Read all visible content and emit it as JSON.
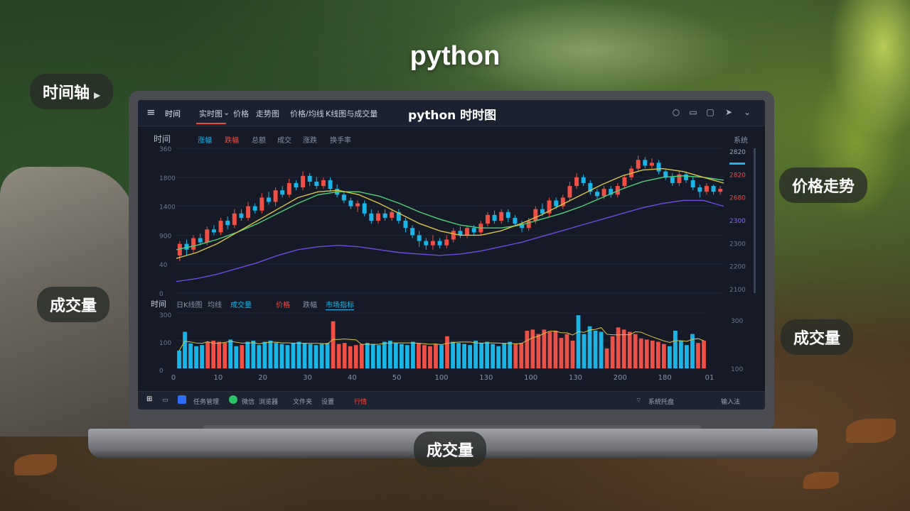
{
  "overlay": {
    "title": "python",
    "tags": {
      "timeline": "时间轴",
      "volume_left": "成交量",
      "price_trend": "价格走势",
      "volume_right": "成交量",
      "volume_bottom": "成交量"
    }
  },
  "app": {
    "title": "python 时时图",
    "tabs": [
      "时间",
      "实时图",
      "价格",
      "走势图",
      "价格/均线",
      "K线图与成交量"
    ],
    "top_icons": [
      "search-icon",
      "layout-icon",
      "window-icon",
      "share-icon",
      "chevron-down-icon"
    ],
    "price_header": {
      "label": "时间",
      "items": [
        "涨幅",
        "跌幅",
        "总额",
        "成交",
        "涨跌",
        "换手率"
      ],
      "right_label": "系统"
    },
    "volume_header": {
      "label": "时间",
      "items": [
        "日K线图",
        "均线",
        "成交量",
        "价格",
        "跌幅",
        "市场指标"
      ]
    },
    "colors": {
      "up": "#ef4f45",
      "down": "#1ab5e6",
      "ma_green": "#4fcf7a",
      "ma_yellow": "#d9c445",
      "ma_purple": "#6c4be0",
      "background": "#151a26"
    },
    "taskbar": {
      "items": [
        "任务管理",
        "微信",
        "浏览器",
        "文件夹",
        "设置",
        "行情"
      ],
      "right_items": [
        "系统托盘",
        "输入法"
      ]
    }
  },
  "chart_data": [
    {
      "type": "candlestick",
      "title": "",
      "y_ticks": [
        "360",
        "1800",
        "1400",
        "900",
        "40",
        "0"
      ],
      "right_ticks": [
        "2820",
        "2820",
        "2680",
        "2300",
        "2300",
        "2200",
        "2100"
      ],
      "ylim": [
        0,
        100
      ],
      "candles": [
        [
          26,
          34,
          22,
          36
        ],
        [
          34,
          30,
          26,
          37
        ],
        [
          30,
          38,
          28,
          40
        ],
        [
          38,
          35,
          33,
          41
        ],
        [
          35,
          44,
          33,
          46
        ],
        [
          44,
          42,
          40,
          47
        ],
        [
          42,
          50,
          40,
          52
        ],
        [
          50,
          47,
          44,
          53
        ],
        [
          47,
          55,
          45,
          58
        ],
        [
          55,
          52,
          50,
          58
        ],
        [
          52,
          60,
          50,
          63
        ],
        [
          60,
          57,
          55,
          62
        ],
        [
          57,
          66,
          55,
          69
        ],
        [
          66,
          63,
          61,
          70
        ],
        [
          63,
          71,
          60,
          73
        ],
        [
          71,
          68,
          66,
          74
        ],
        [
          68,
          76,
          66,
          79
        ],
        [
          76,
          73,
          71,
          78
        ],
        [
          73,
          81,
          71,
          84
        ],
        [
          81,
          77,
          74,
          83
        ],
        [
          77,
          74,
          72,
          80
        ],
        [
          74,
          78,
          72,
          80
        ],
        [
          78,
          72,
          70,
          80
        ],
        [
          72,
          68,
          66,
          75
        ],
        [
          68,
          64,
          62,
          70
        ],
        [
          64,
          60,
          58,
          66
        ],
        [
          60,
          62,
          56,
          64
        ],
        [
          62,
          55,
          53,
          64
        ],
        [
          55,
          50,
          48,
          58
        ],
        [
          50,
          55,
          48,
          57
        ],
        [
          55,
          52,
          50,
          58
        ],
        [
          52,
          56,
          50,
          58
        ],
        [
          56,
          50,
          48,
          58
        ],
        [
          50,
          45,
          42,
          52
        ],
        [
          45,
          40,
          38,
          47
        ],
        [
          40,
          36,
          32,
          43
        ],
        [
          36,
          33,
          30,
          38
        ],
        [
          33,
          36,
          30,
          40
        ],
        [
          36,
          33,
          31,
          38
        ],
        [
          33,
          37,
          31,
          40
        ],
        [
          37,
          43,
          35,
          45
        ],
        [
          43,
          40,
          38,
          46
        ],
        [
          40,
          45,
          38,
          47
        ],
        [
          45,
          42,
          40,
          47
        ],
        [
          42,
          48,
          40,
          50
        ],
        [
          48,
          54,
          46,
          56
        ],
        [
          54,
          50,
          48,
          57
        ],
        [
          50,
          56,
          48,
          58
        ],
        [
          56,
          52,
          49,
          58
        ],
        [
          52,
          48,
          46,
          54
        ],
        [
          48,
          45,
          42,
          50
        ],
        [
          45,
          50,
          43,
          52
        ],
        [
          50,
          58,
          48,
          60
        ],
        [
          58,
          55,
          53,
          62
        ],
        [
          55,
          64,
          53,
          66
        ],
        [
          64,
          60,
          58,
          66
        ],
        [
          60,
          66,
          58,
          68
        ],
        [
          66,
          74,
          64,
          77
        ],
        [
          74,
          80,
          72,
          83
        ],
        [
          80,
          76,
          74,
          82
        ],
        [
          76,
          70,
          68,
          78
        ],
        [
          70,
          67,
          65,
          72
        ],
        [
          67,
          72,
          65,
          74
        ],
        [
          72,
          68,
          66,
          74
        ],
        [
          68,
          74,
          66,
          76
        ],
        [
          74,
          80,
          72,
          82
        ],
        [
          80,
          86,
          78,
          88
        ],
        [
          86,
          92,
          84,
          95
        ],
        [
          92,
          88,
          86,
          94
        ],
        [
          88,
          90,
          86,
          93
        ],
        [
          90,
          84,
          82,
          92
        ],
        [
          84,
          80,
          78,
          86
        ],
        [
          80,
          76,
          74,
          83
        ],
        [
          76,
          82,
          74,
          84
        ],
        [
          82,
          78,
          76,
          84
        ],
        [
          78,
          73,
          71,
          80
        ],
        [
          73,
          70,
          66,
          75
        ],
        [
          70,
          74,
          68,
          76
        ],
        [
          74,
          70,
          68,
          75
        ],
        [
          70,
          72,
          68,
          74
        ]
      ],
      "ma_green": [
        30,
        33,
        37,
        42,
        48,
        55,
        62,
        68,
        70,
        70,
        67,
        62,
        56,
        51,
        47,
        45,
        45,
        47,
        51,
        55,
        60,
        66,
        72,
        77,
        80,
        81,
        80,
        78
      ],
      "ma_yellow": [
        24,
        28,
        34,
        42,
        50,
        58,
        66,
        70,
        71,
        68,
        62,
        55,
        48,
        43,
        40,
        40,
        43,
        48,
        54,
        61,
        68,
        75,
        81,
        85,
        86,
        84,
        80,
        76
      ],
      "ma_purple": [
        8,
        10,
        13,
        17,
        21,
        26,
        30,
        32,
        33,
        32,
        30,
        28,
        27,
        26,
        27,
        29,
        32,
        35,
        39,
        43,
        47,
        51,
        55,
        59,
        62,
        64,
        64,
        60
      ]
    },
    {
      "type": "bar",
      "title": "",
      "y_ticks": [
        "300",
        "100",
        "0"
      ],
      "right_ticks": [
        "300",
        "100"
      ],
      "x_ticks": [
        "0",
        "10",
        "20",
        "30",
        "40",
        "50",
        "100",
        "130",
        "100",
        "130",
        "200",
        "180",
        "01"
      ],
      "ylim": [
        0,
        100
      ],
      "values": [
        32,
        66,
        45,
        40,
        42,
        48,
        50,
        48,
        46,
        52,
        40,
        42,
        48,
        50,
        42,
        48,
        50,
        46,
        44,
        42,
        46,
        48,
        46,
        44,
        42,
        44,
        46,
        85,
        44,
        46,
        40,
        42,
        44,
        46,
        44,
        42,
        48,
        50,
        46,
        44,
        42,
        48,
        46,
        42,
        40,
        44,
        42,
        58,
        48,
        46,
        44,
        42,
        50,
        46,
        48,
        44,
        40,
        46,
        48,
        44,
        46,
        68,
        70,
        62,
        70,
        66,
        68,
        55,
        62,
        50,
        96,
        62,
        76,
        68,
        66,
        36,
        58,
        74,
        70,
        66,
        62,
        54,
        52,
        50,
        48,
        44,
        40,
        68,
        50,
        42,
        62,
        46,
        50
      ],
      "colors": [
        "d",
        "d",
        "d",
        "d",
        "d",
        "u",
        "u",
        "u",
        "u",
        "d",
        "d",
        "u",
        "d",
        "d",
        "d",
        "d",
        "d",
        "d",
        "d",
        "d",
        "d",
        "d",
        "d",
        "d",
        "d",
        "d",
        "d",
        "u",
        "u",
        "u",
        "u",
        "u",
        "u",
        "d",
        "d",
        "d",
        "d",
        "d",
        "d",
        "d",
        "d",
        "d",
        "u",
        "u",
        "u",
        "u",
        "d",
        "u",
        "d",
        "d",
        "d",
        "d",
        "d",
        "d",
        "d",
        "d",
        "d",
        "d",
        "d",
        "u",
        "u",
        "u",
        "u",
        "u",
        "u",
        "u",
        "u",
        "u",
        "u",
        "u",
        "d",
        "d",
        "d",
        "d",
        "d",
        "u",
        "u",
        "u",
        "u",
        "u",
        "u",
        "u",
        "u",
        "u",
        "u",
        "u",
        "d",
        "d",
        "d",
        "d",
        "d",
        "u",
        "u"
      ]
    }
  ]
}
